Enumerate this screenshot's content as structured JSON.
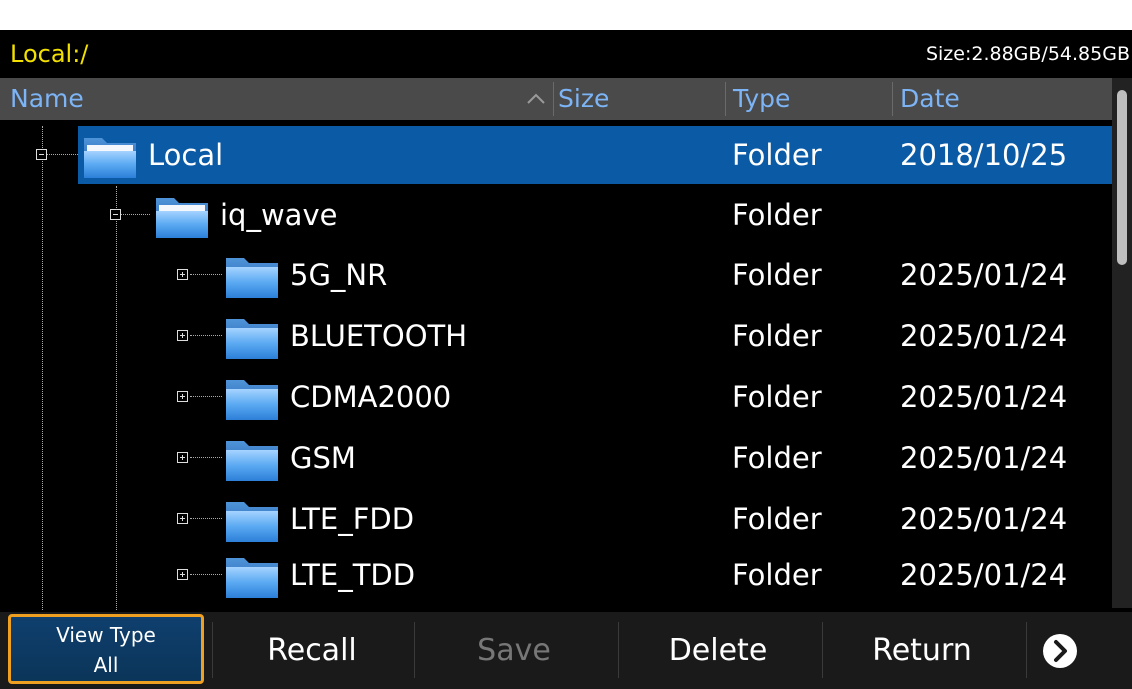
{
  "path_bar": {
    "path": "Local:/",
    "size_info": "Size:2.88GB/54.85GB"
  },
  "columns": {
    "name": "Name",
    "size": "Size",
    "type": "Type",
    "date": "Date",
    "sort_icon": "sort-ascending-icon"
  },
  "rows": [
    {
      "name": "Local",
      "type": "Folder",
      "date": "2018/10/25",
      "selected": true,
      "expander": "minus"
    },
    {
      "name": "iq_wave",
      "type": "Folder",
      "date": "",
      "expander": "minus"
    },
    {
      "name": "5G_NR",
      "type": "Folder",
      "date": "2025/01/24",
      "expander": "plus"
    },
    {
      "name": "BLUETOOTH",
      "type": "Folder",
      "date": "2025/01/24",
      "expander": "plus"
    },
    {
      "name": "CDMA2000",
      "type": "Folder",
      "date": "2025/01/24",
      "expander": "plus"
    },
    {
      "name": "GSM",
      "type": "Folder",
      "date": "2025/01/24",
      "expander": "plus"
    },
    {
      "name": "LTE_FDD",
      "type": "Folder",
      "date": "2025/01/24",
      "expander": "plus"
    },
    {
      "name": "LTE_TDD",
      "type": "Folder",
      "date": "2025/01/24",
      "expander": "plus"
    }
  ],
  "softkeys": {
    "view_type_label": "View Type",
    "view_type_value": "All",
    "recall": "Recall",
    "save": "Save",
    "delete": "Delete",
    "return": "Return",
    "more_icon": "chevron-right-circle-icon"
  },
  "colors": {
    "path": "#f2e000",
    "header_text": "#7db4f5",
    "header_bg": "#4a4a4a",
    "selection": "#0a5aa6",
    "focus_border": "#f0a020",
    "disabled_text": "#777777"
  }
}
